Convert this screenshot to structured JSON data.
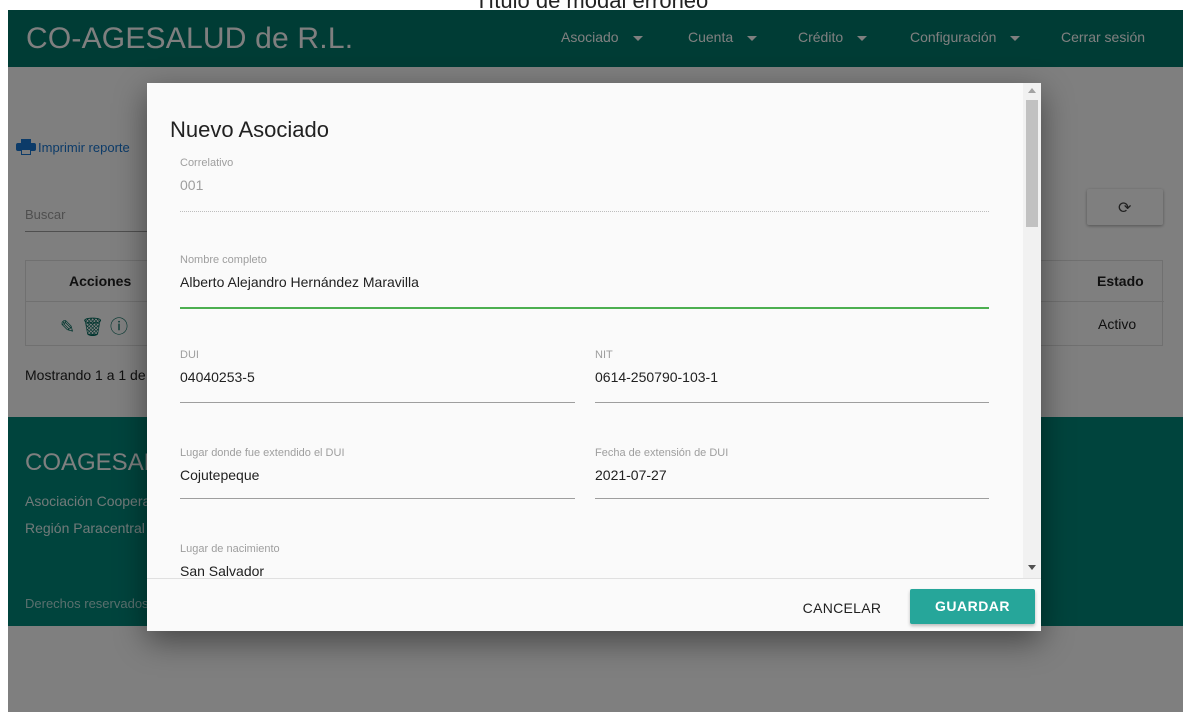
{
  "caption": "Título de modal erroneo",
  "app": {
    "title": "CO-AGESALUD de R.L."
  },
  "nav": {
    "asociado": "Asociado",
    "cuenta": "Cuenta",
    "credito": "Crédito",
    "configuracion": "Configuración",
    "logout": "Cerrar sesión"
  },
  "page": {
    "print_link": "Imprimir reporte",
    "search_placeholder": "Buscar",
    "table_headers": {
      "actions": "Acciones",
      "status": "Estado"
    },
    "row": {
      "status": "Activo"
    },
    "showing": "Mostrando 1 a 1 de"
  },
  "footer": {
    "title": "COAGESALUD",
    "line1": "Asociación Cooperativa",
    "line2": "Región Paracentral",
    "copyright": "Derechos reservados"
  },
  "modal": {
    "title": "Nuevo Asociado",
    "fields": {
      "correlativo": {
        "label": "Correlativo",
        "value": "001"
      },
      "nombre": {
        "label": "Nombre completo",
        "value": "Alberto Alejandro Hernández Maravilla"
      },
      "dui": {
        "label": "DUI",
        "value": "04040253-5"
      },
      "nit": {
        "label": "NIT",
        "value": "0614-250790-103-1"
      },
      "lugar_dui": {
        "label": "Lugar donde fue extendido el DUI",
        "value": "Cojutepeque"
      },
      "fecha_dui": {
        "label": "Fecha de extensión de DUI",
        "value": "2021-07-27"
      },
      "lugar_nacimiento": {
        "label": "Lugar de nacimiento",
        "value": "San Salvador"
      }
    },
    "cancel_label": "CANCELAR",
    "save_label": "GUARDAR"
  },
  "colors": {
    "navbar": "#00796b",
    "footer": "#00897b",
    "primary_button": "#26a69a",
    "focus_underline": "#4caf50",
    "link": "#1976d2"
  }
}
